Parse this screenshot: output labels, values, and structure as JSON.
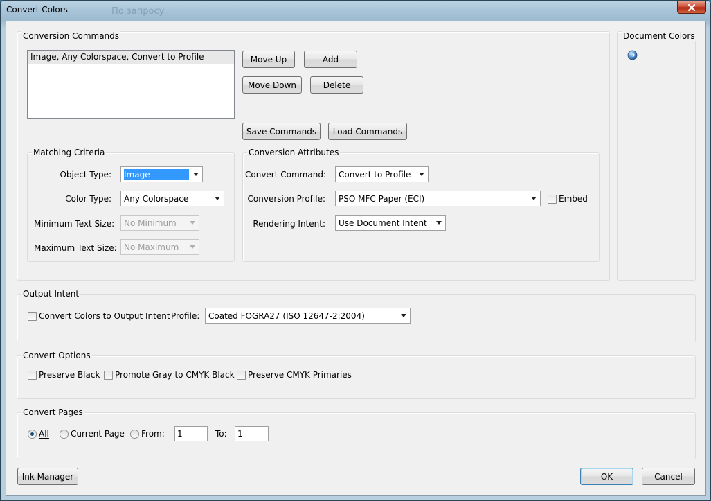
{
  "window": {
    "title": "Convert Colors",
    "background_title": "По запросу"
  },
  "conversion_commands": {
    "title": "Conversion Commands",
    "items": [
      "Image, Any Colorspace, Convert to Profile"
    ],
    "move_up": "Move Up",
    "add": "Add",
    "move_down": "Move Down",
    "delete": "Delete",
    "save_commands": "Save Commands",
    "load_commands": "Load Commands"
  },
  "matching_criteria": {
    "title": "Matching Criteria",
    "object_type_label": "Object Type:",
    "object_type_value": "Image",
    "color_type_label": "Color Type:",
    "color_type_value": "Any Colorspace",
    "min_text_label": "Minimum Text Size:",
    "min_text_value": "No Minimum",
    "max_text_label": "Maximum Text Size:",
    "max_text_value": "No Maximum"
  },
  "conversion_attributes": {
    "title": "Conversion Attributes",
    "command_label": "Convert Command:",
    "command_value": "Convert to Profile",
    "profile_label": "Conversion Profile:",
    "profile_value": "PSO MFC Paper (ECI)",
    "embed_label": "Embed",
    "intent_label": "Rendering Intent:",
    "intent_value": "Use Document Intent"
  },
  "document_colors": {
    "title": "Document Colors"
  },
  "output_intent": {
    "title": "Output Intent",
    "convert_label": "Convert Colors to Output Intent",
    "profile_label": "Profile:",
    "profile_value": "Coated FOGRA27 (ISO 12647-2:2004)"
  },
  "convert_options": {
    "title": "Convert Options",
    "preserve_black": "Preserve Black",
    "promote_gray": "Promote Gray to CMYK Black",
    "preserve_cmyk": "Preserve CMYK Primaries"
  },
  "convert_pages": {
    "title": "Convert Pages",
    "all_label": "All",
    "current_label": "Current Page",
    "from_label": "From:",
    "from_value": "1",
    "to_label": "To:",
    "to_value": "1"
  },
  "footer": {
    "ink_manager": "Ink Manager",
    "ok": "OK",
    "cancel": "Cancel"
  },
  "colors": {
    "selection": "#3399ff",
    "client_bg": "#f0f0f0",
    "close_red": "#c8442c"
  }
}
